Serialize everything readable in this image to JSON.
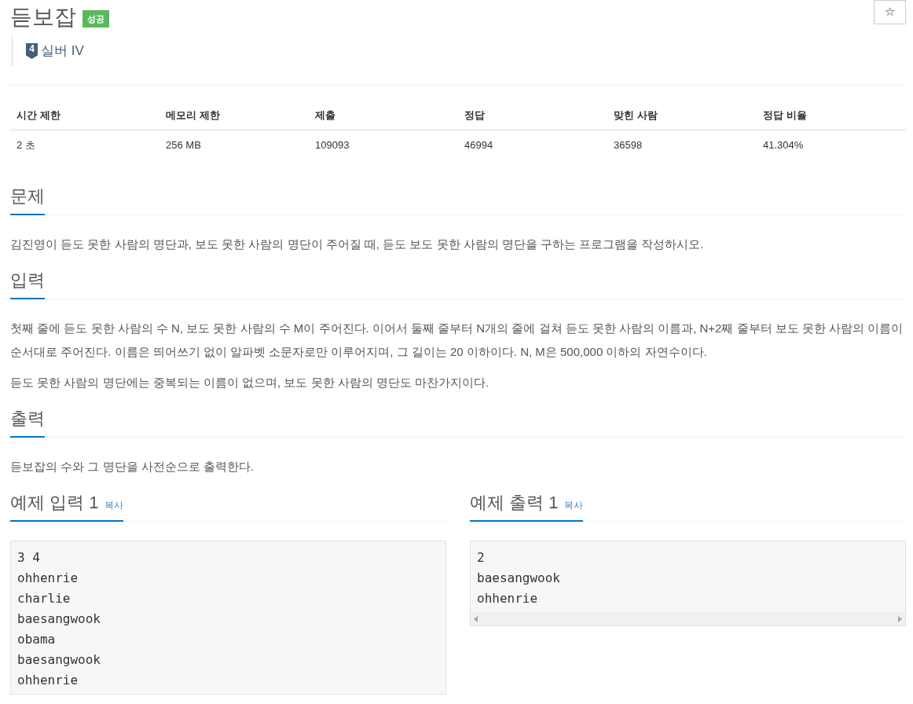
{
  "title": "듣보잡",
  "result_badge": "성공",
  "starred": false,
  "star_button": "☆",
  "tier": {
    "number": "4",
    "label": "실버 IV"
  },
  "stats": {
    "columns": [
      "시간 제한",
      "메모리 제한",
      "제출",
      "정답",
      "맞힌 사람",
      "정답 비율"
    ],
    "row": [
      "2 초",
      "256 MB",
      "109093",
      "46994",
      "36598",
      "41.304%"
    ]
  },
  "sections": [
    {
      "heading": "문제",
      "paragraphs": [
        "김진영이 듣도 못한 사람의 명단과, 보도 못한 사람의 명단이 주어질 때, 듣도 보도 못한 사람의 명단을 구하는 프로그램을 작성하시오."
      ]
    },
    {
      "heading": "입력",
      "paragraphs": [
        "첫째 줄에 듣도 못한 사람의 수 N, 보도 못한 사람의 수 M이 주어진다. 이어서 둘째 줄부터 N개의 줄에 걸쳐 듣도 못한 사람의 이름과, N+2째 줄부터 보도 못한 사람의 이름이 순서대로 주어진다. 이름은 띄어쓰기 없이 알파벳 소문자로만 이루어지며, 그 길이는 20 이하이다. N, M은 500,000 이하의 자연수이다.",
        "듣도 못한 사람의 명단에는 중복되는 이름이 없으며, 보도 못한 사람의 명단도 마찬가지이다."
      ]
    },
    {
      "heading": "출력",
      "paragraphs": [
        "듣보잡의 수와 그 명단을 사전순으로 출력한다."
      ]
    }
  ],
  "samples": [
    {
      "heading": "예제 입력 1",
      "copy": "복사",
      "lines": [
        "3 4",
        "ohhenrie",
        "charlie",
        "baesangwook",
        "obama",
        "baesangwook",
        "ohhenrie"
      ],
      "scrollbar": false
    },
    {
      "heading": "예제 출력 1",
      "copy": "복사",
      "lines": [
        "2",
        "baesangwook",
        "ohhenrie"
      ],
      "scrollbar": true
    }
  ]
}
